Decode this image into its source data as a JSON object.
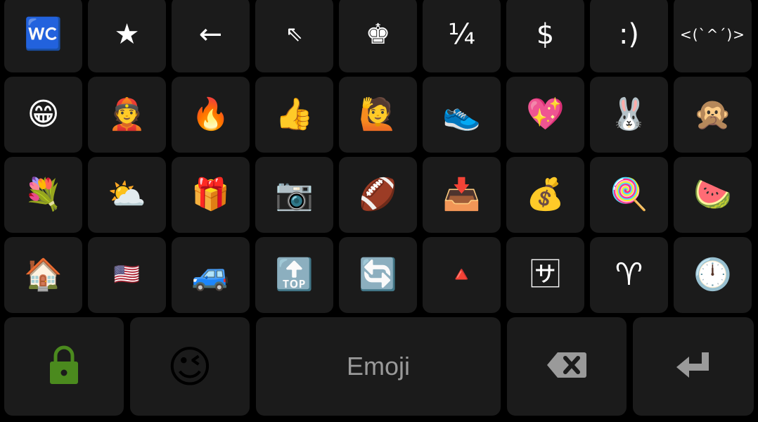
{
  "keyboard": {
    "rows": [
      [
        "🚾",
        "★",
        "←",
        "⇖",
        "♚",
        "¼",
        "$",
        ":)",
        "<(`^´)>"
      ],
      [
        "😁",
        "👲",
        "🔥",
        "👍",
        "🙋",
        "👟",
        "💖",
        "🐰",
        "🙊"
      ],
      [
        "💐",
        "⛅",
        "🎁",
        "📷",
        "🏈",
        "📥",
        "💰",
        "🍭",
        "🍉"
      ],
      [
        "🏠",
        "🇺🇸",
        "🚙",
        "🔝",
        "🔄",
        "🔺",
        "🈂",
        "♈",
        "🕛"
      ]
    ],
    "bottom": {
      "lock_icon": "lock-icon",
      "emoji_key": "😉",
      "space_label": "Emoji",
      "backspace_icon": "backspace-icon",
      "enter_icon": "enter-icon"
    },
    "colors": {
      "background": "#000000",
      "key": "#1b1b1b",
      "lock": "#4b8a1e",
      "muted_icon": "#9a9a9a"
    }
  }
}
